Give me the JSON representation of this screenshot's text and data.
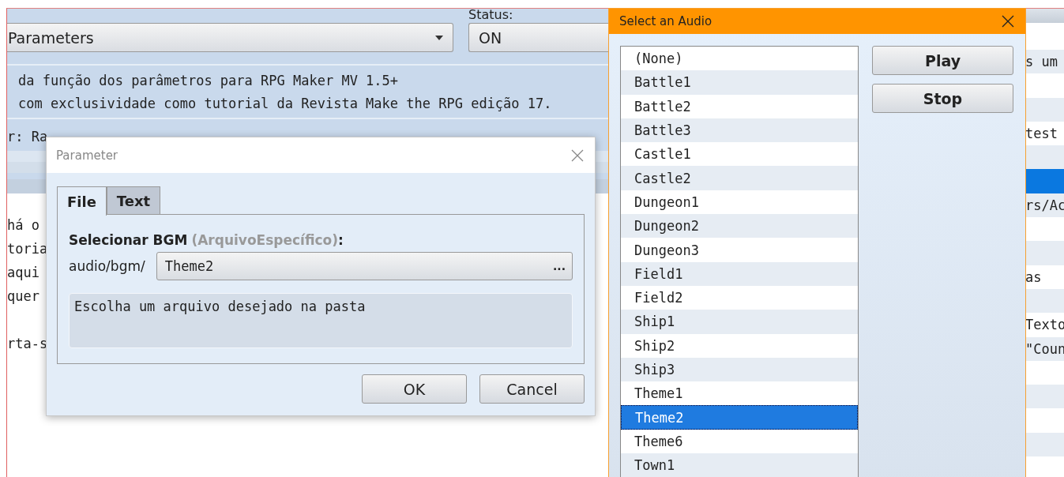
{
  "main_window": {
    "header_label": "Status:",
    "plugin_select": {
      "value": "Parameters"
    },
    "status_select": {
      "value": "ON"
    },
    "description": [
      "da função dos parâmetros para RPG Maker MV 1.5+",
      "com exclusividade como tutorial da Revista Make the RPG edição 17."
    ],
    "author_fragment": "r: Ra",
    "note_paragraphs": [
      [
        "há o",
        "toria",
        "aqui",
        "quer"
      ],
      [
        "rta-s"
      ]
    ],
    "command_list": [
      {
        "text": "s um",
        "selected": false
      },
      {
        "selected": false
      },
      {
        "selected": false
      },
      {
        "text": "test",
        "selected": false
      },
      {
        "selected": false
      },
      {
        "selected": true
      },
      {
        "text": "rs/Ac",
        "selected": false
      },
      {
        "selected": false
      },
      {
        "selected": false
      },
      {
        "text": "as",
        "selected": false
      },
      {
        "selected": false
      },
      {
        "text": "Texto",
        "selected": false
      },
      {
        "text": "\"Coun",
        "selected": false
      },
      {
        "selected": false
      },
      {
        "selected": false
      },
      {
        "selected": false
      },
      {
        "selected": false
      },
      {
        "selected": false
      }
    ]
  },
  "parameter_dialog": {
    "title": "Parameter",
    "tabs": [
      {
        "label": "File",
        "selected": true
      },
      {
        "label": "Text",
        "selected": false
      }
    ],
    "field_label": "Selecionar BGM",
    "field_hint": "(ArquivoEspecífico)",
    "field_suffix": ":",
    "path_prefix": "audio/bgm/",
    "file_value": "Theme2",
    "browse_label": "...",
    "description": "Escolha um arquivo desejado na pasta",
    "buttons": [
      "OK",
      "Cancel"
    ]
  },
  "audio_dialog": {
    "title": "Select an Audio",
    "items": [
      {
        "label": "(None)",
        "selected": false
      },
      {
        "label": "Battle1",
        "selected": false
      },
      {
        "label": "Battle2",
        "selected": false
      },
      {
        "label": "Battle3",
        "selected": false
      },
      {
        "label": "Castle1",
        "selected": false
      },
      {
        "label": "Castle2",
        "selected": false
      },
      {
        "label": "Dungeon1",
        "selected": false
      },
      {
        "label": "Dungeon2",
        "selected": false
      },
      {
        "label": "Dungeon3",
        "selected": false
      },
      {
        "label": "Field1",
        "selected": false
      },
      {
        "label": "Field2",
        "selected": false
      },
      {
        "label": "Ship1",
        "selected": false
      },
      {
        "label": "Ship2",
        "selected": false
      },
      {
        "label": "Ship3",
        "selected": false
      },
      {
        "label": "Theme1",
        "selected": false
      },
      {
        "label": "Theme2",
        "selected": true
      },
      {
        "label": "Theme6",
        "selected": false
      },
      {
        "label": "Town1",
        "selected": false
      }
    ],
    "buttons": [
      "Play",
      "Stop"
    ]
  }
}
